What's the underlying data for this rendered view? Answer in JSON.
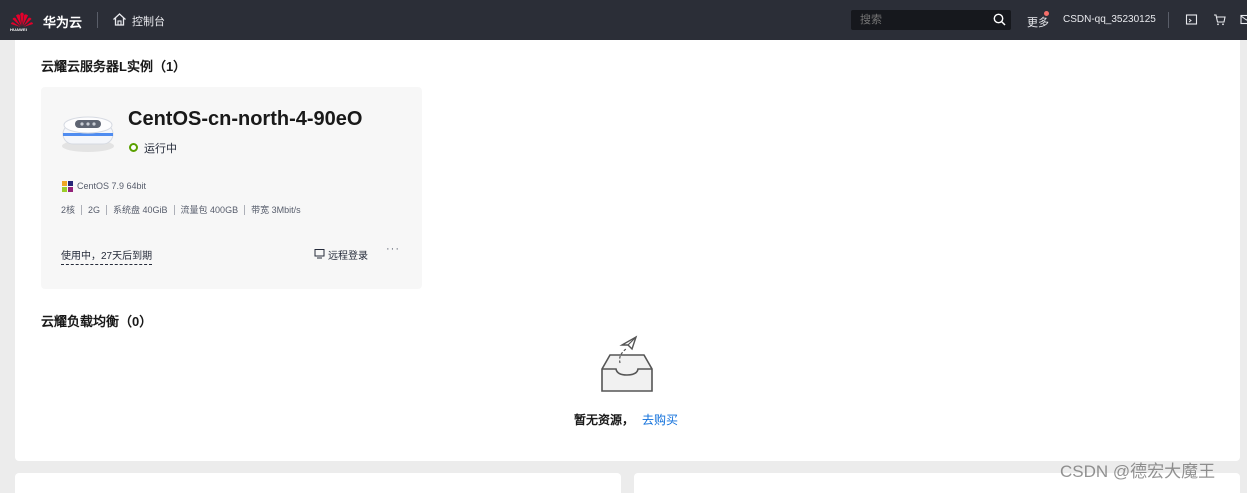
{
  "header": {
    "logo_text": "HUAWEI",
    "brand": "华为云",
    "console": "控制台",
    "search_placeholder": "搜索",
    "more": "更多",
    "user": "CSDN-qq_35230125"
  },
  "instances_section": {
    "title": "云耀云服务器L实例（1）",
    "card": {
      "name": "CentOS-cn-north-4-90eO",
      "status": "运行中",
      "os": "CentOS 7.9 64bit",
      "specs": [
        "2核",
        "2G",
        "系统盘 40GiB",
        "流量包 400GB",
        "带宽 3Mbit/s"
      ],
      "expire": "使用中，27天后到期",
      "remote_login": "远程登录",
      "more_actions": "···"
    }
  },
  "lb_section": {
    "title": "云耀负载均衡（0）",
    "empty_text": "暂无资源，",
    "buy_link": "去购买"
  },
  "watermark": "CSDN @德宏大魔王",
  "colors": {
    "topbar": "#2b2e37",
    "status_ok": "#5aa000",
    "link": "#0d6edb",
    "notify_dot": "#f66f6a"
  },
  "icons": [
    "huawei-logo-icon",
    "home-icon",
    "search-icon",
    "notice-icon",
    "cart-icon",
    "mail-icon",
    "monitor-icon",
    "centos-icon"
  ]
}
